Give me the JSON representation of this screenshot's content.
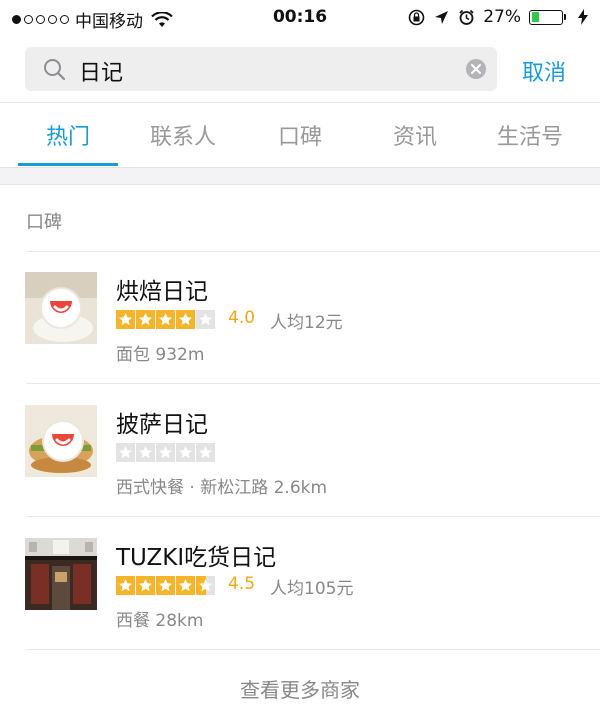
{
  "status_bar": {
    "carrier": "中国移动",
    "time": "00:16",
    "battery_percent": "27%",
    "battery_level": 0.27,
    "battery_color": "#2fc94b",
    "signal_bars": 1
  },
  "search": {
    "query": "日记",
    "cancel_label": "取消"
  },
  "tabs": [
    {
      "label": "热门",
      "active": true
    },
    {
      "label": "联系人",
      "active": false
    },
    {
      "label": "口碑",
      "active": false
    },
    {
      "label": "资讯",
      "active": false
    },
    {
      "label": "生活号",
      "active": false
    }
  ],
  "section": {
    "title": "口碑"
  },
  "results": [
    {
      "name": "烘焙日记",
      "stars": 4,
      "rating": "4.0",
      "avg_price": "人均12元",
      "meta": "面包 932m",
      "icon": "smile-logo-icon"
    },
    {
      "name": "披萨日记",
      "stars": 0,
      "rating": "",
      "avg_price": "",
      "meta": "西式快餐 · 新松江路 2.6km",
      "icon": "smile-logo-icon"
    },
    {
      "name": "TUZKI吃货日记",
      "stars": 4.5,
      "rating": "4.5",
      "avg_price": "人均105元",
      "meta": "西餐 28km",
      "icon": "storefront-photo"
    }
  ],
  "more_label": "查看更多商家",
  "colors": {
    "accent": "#1a9bd8",
    "star": "#f5b52a",
    "rating_text": "#f0a81b",
    "logo_red": "#e8473a"
  }
}
